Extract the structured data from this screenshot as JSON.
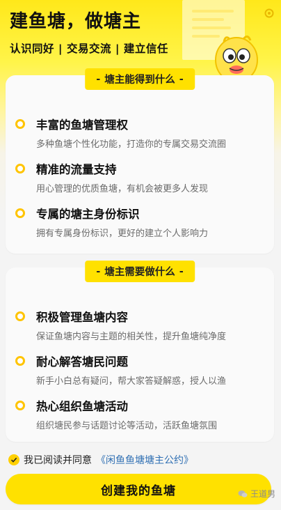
{
  "header": {
    "title": "建鱼塘，做塘主",
    "subtitle": "认识同好 | 交易交流 | 建立信任"
  },
  "section_benefits": {
    "label": "塘主能得到什么",
    "items": [
      {
        "title": "丰富的鱼塘管理权",
        "desc": "多种鱼塘个性化功能，打造你的专属交易交流圈"
      },
      {
        "title": "精准的流量支持",
        "desc": "用心管理的优质鱼塘，有机会被更多人发现"
      },
      {
        "title": "专属的塘主身份标识",
        "desc": "拥有专属身份标识，更好的建立个人影响力"
      }
    ]
  },
  "section_duties": {
    "label": "塘主需要做什么",
    "items": [
      {
        "title": "积极管理鱼塘内容",
        "desc": "保证鱼塘内容与主题的相关性，提升鱼塘纯净度"
      },
      {
        "title": "耐心解答塘民问题",
        "desc": "新手小白总有疑问，帮大家答疑解惑，授人以渔"
      },
      {
        "title": "热心组织鱼塘活动",
        "desc": "组织塘民参与话题讨论等活动，活跃鱼塘氛围"
      }
    ]
  },
  "agreement": {
    "text": "我已阅读并同意",
    "link": "《闲鱼鱼塘塘主公约》",
    "checked": true
  },
  "create_button": {
    "label": "创建我的鱼塘"
  },
  "watermark": {
    "text": "王道男"
  },
  "colors": {
    "accent": "#ffe100",
    "bullet": "#ffc400",
    "link": "#2f6fb3"
  }
}
